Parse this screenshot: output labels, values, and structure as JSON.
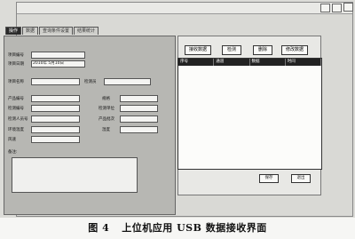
{
  "tabs": [
    "操作",
    "数据",
    "查询条件设置",
    "结果统计"
  ],
  "form": {
    "fields": [
      {
        "label": "项目编号",
        "value": ""
      },
      {
        "label": "项目日期",
        "value": "2010年 5月10日"
      },
      {
        "label": "项目名称",
        "value": ""
      },
      {
        "label": "检测员",
        "value": ""
      },
      {
        "label": "产品编号",
        "value": ""
      },
      {
        "label": "规格",
        "value": ""
      },
      {
        "label": "检测编号",
        "value": ""
      },
      {
        "label": "检测单位",
        "value": ""
      },
      {
        "label": "检测人员号",
        "value": ""
      },
      {
        "label": "产品批次",
        "value": ""
      },
      {
        "label": "环境温度",
        "value": ""
      },
      {
        "label": "湿度",
        "value": ""
      },
      {
        "label": "风速",
        "value": ""
      }
    ],
    "notes_label": "备注:"
  },
  "toolbar": {
    "buttons": [
      "接收数据",
      "检测",
      "删除",
      "修改数据"
    ]
  },
  "table": {
    "columns": [
      "序号",
      "通道",
      "数据",
      "时间"
    ]
  },
  "bottom_buttons": [
    "保存",
    "退出"
  ],
  "caption": {
    "number": "图 4",
    "text": "上位机应用 USB 数据接收界面"
  }
}
